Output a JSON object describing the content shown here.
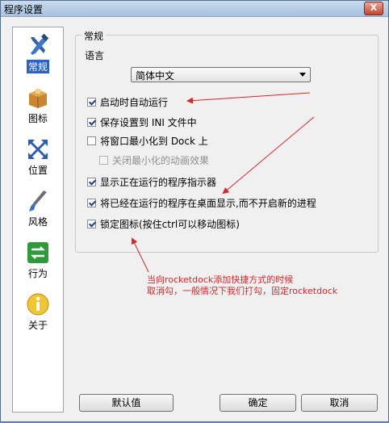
{
  "window": {
    "title": "程序设置",
    "close_label": "X"
  },
  "sidebar": {
    "items": [
      {
        "label": "常规",
        "icon": "tools-icon",
        "active": true
      },
      {
        "label": "图标",
        "icon": "box-icon",
        "active": false
      },
      {
        "label": "位置",
        "icon": "arrows-icon",
        "active": false
      },
      {
        "label": "风格",
        "icon": "brush-icon",
        "active": false
      },
      {
        "label": "行为",
        "icon": "exchange-icon",
        "active": false
      },
      {
        "label": "关于",
        "icon": "info-icon",
        "active": false
      }
    ]
  },
  "general": {
    "group_title": "常规",
    "language_label": "语言",
    "language_value": "简体中文",
    "options": [
      {
        "label": "启动时自动运行",
        "checked": true,
        "disabled": false
      },
      {
        "label": "保存设置到 INI 文件中",
        "checked": true,
        "disabled": false
      },
      {
        "label": "将窗口最小化到 Dock 上",
        "checked": false,
        "disabled": false
      },
      {
        "label": "关闭最小化的动画效果",
        "checked": false,
        "disabled": true
      },
      {
        "label": "显示正在运行的程序指示器",
        "checked": true,
        "disabled": false
      },
      {
        "label": "将已经在运行的程序在桌面显示,而不开启新的进程",
        "checked": true,
        "disabled": false
      },
      {
        "label": "锁定图标(按住ctrl可以移动图标)",
        "checked": true,
        "disabled": false
      }
    ]
  },
  "annotation": {
    "line1": "当向rocketdock添加快捷方式的时候",
    "line2": "取消勾，一般情况下我们打勾，固定rocketdock",
    "color": "#d8262a"
  },
  "buttons": {
    "default": "默认值",
    "ok": "确定",
    "cancel": "取消"
  }
}
